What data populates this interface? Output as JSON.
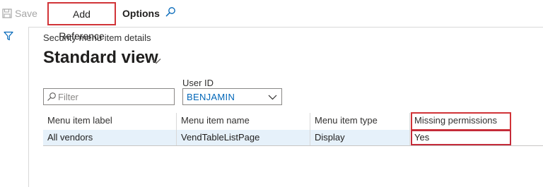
{
  "action_pane": {
    "save_label": "Save",
    "add_reference_label": "Add Reference",
    "options_label": "Options",
    "search_icon": "search-icon"
  },
  "page": {
    "caption": "Security menu item details",
    "view_title": "Standard view"
  },
  "filter": {
    "placeholder": "Filter"
  },
  "user_id": {
    "label": "User ID",
    "value": "BENJAMIN"
  },
  "grid": {
    "columns": [
      "Menu item label",
      "Menu item name",
      "Menu item type",
      "Missing permissions"
    ],
    "rows": [
      {
        "label": "All vendors",
        "name": "VendTableListPage",
        "type": "Display",
        "missing": "Yes"
      }
    ]
  },
  "colors": {
    "highlight": "#d13438",
    "selected_row": "#e6f1fa",
    "link_value": "#0066b8"
  }
}
